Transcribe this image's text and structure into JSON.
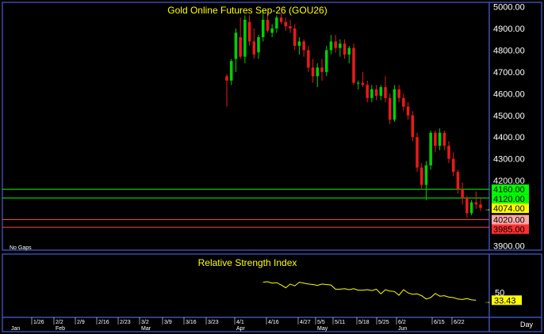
{
  "colors": {
    "background": "#000000",
    "border": "#3a4ba8",
    "title_text": "#ffff00",
    "axis_text": "#ffffff",
    "up_candle": "#00d000",
    "down_candle": "#e81a1a",
    "rsi_line": "#ffff00",
    "line_4160": "#00ff00",
    "line_4120": "#00ff00",
    "line_4020": "#ff4040",
    "line_3985": "#ff4040",
    "tag_4160": "#00ff00",
    "tag_4120": "#00ff00",
    "tag_4074": "#ffff00",
    "tag_4020": "#ffa8a8",
    "tag_3985": "#ff3030"
  },
  "main_title": "Gold Online Futures Sep-26 (GOU26)",
  "rsi_title": "Relative Strength Index",
  "no_gaps_label": "No Gaps",
  "period_label": "Day",
  "chart_data": [
    {
      "type": "candlestick",
      "title": "Gold Online Futures Sep-26 (GOU26)",
      "ylim": [
        3880,
        5020
      ],
      "y_ticks": [
        "5000.00",
        "4900.00",
        "4800.00",
        "4700.00",
        "4600.00",
        "4500.00",
        "4400.00",
        "4300.00",
        "4200.00",
        "4100.00",
        "4000.00",
        "3900.00"
      ],
      "y_tick_values": [
        5000,
        4900,
        4800,
        4700,
        4600,
        4500,
        4400,
        4300,
        4200,
        4100,
        4000,
        3900
      ],
      "price_lines": [
        {
          "value": 4160,
          "label": "4160.00",
          "key": "4160"
        },
        {
          "value": 4120,
          "label": "4120.00",
          "key": "4120"
        },
        {
          "value": 4020,
          "label": "4020.00",
          "key": "4020"
        },
        {
          "value": 3985,
          "label": "3985.00",
          "key": "3985"
        }
      ],
      "last_price": {
        "value": 4074,
        "label": "4074.00"
      },
      "candles": [
        {
          "open": 4680,
          "high": 4690,
          "low": 4540,
          "close": 4660
        },
        {
          "open": 4660,
          "high": 4760,
          "low": 4640,
          "close": 4750
        },
        {
          "open": 4760,
          "high": 4900,
          "low": 4700,
          "close": 4880
        },
        {
          "open": 4860,
          "high": 4950,
          "low": 4760,
          "close": 4770
        },
        {
          "open": 4770,
          "high": 4960,
          "low": 4740,
          "close": 4940
        },
        {
          "open": 4930,
          "high": 4960,
          "low": 4820,
          "close": 4840
        },
        {
          "open": 4840,
          "high": 4900,
          "low": 4760,
          "close": 4780
        },
        {
          "open": 4790,
          "high": 4870,
          "low": 4760,
          "close": 4860
        },
        {
          "open": 4860,
          "high": 4980,
          "low": 4840,
          "close": 4940
        },
        {
          "open": 4940,
          "high": 4970,
          "low": 4880,
          "close": 4890
        },
        {
          "open": 4880,
          "high": 4920,
          "low": 4860,
          "close": 4900
        },
        {
          "open": 4900,
          "high": 4960,
          "low": 4880,
          "close": 4950
        },
        {
          "open": 4950,
          "high": 4970,
          "low": 4920,
          "close": 4930
        },
        {
          "open": 4930,
          "high": 4950,
          "low": 4890,
          "close": 4910
        },
        {
          "open": 4910,
          "high": 4940,
          "low": 4880,
          "close": 4900
        },
        {
          "open": 4900,
          "high": 4920,
          "low": 4800,
          "close": 4820
        },
        {
          "open": 4820,
          "high": 4860,
          "low": 4780,
          "close": 4840
        },
        {
          "open": 4840,
          "high": 4850,
          "low": 4770,
          "close": 4800
        },
        {
          "open": 4800,
          "high": 4820,
          "low": 4700,
          "close": 4720
        },
        {
          "open": 4720,
          "high": 4760,
          "low": 4650,
          "close": 4680
        },
        {
          "open": 4680,
          "high": 4740,
          "low": 4630,
          "close": 4720
        },
        {
          "open": 4720,
          "high": 4760,
          "low": 4660,
          "close": 4700
        },
        {
          "open": 4700,
          "high": 4820,
          "low": 4680,
          "close": 4800
        },
        {
          "open": 4800,
          "high": 4870,
          "low": 4780,
          "close": 4840
        },
        {
          "open": 4840,
          "high": 4870,
          "low": 4790,
          "close": 4810
        },
        {
          "open": 4810,
          "high": 4850,
          "low": 4770,
          "close": 4830
        },
        {
          "open": 4830,
          "high": 4850,
          "low": 4760,
          "close": 4780
        },
        {
          "open": 4780,
          "high": 4820,
          "low": 4740,
          "close": 4810
        },
        {
          "open": 4810,
          "high": 4830,
          "low": 4640,
          "close": 4650
        },
        {
          "open": 4650,
          "high": 4660,
          "low": 4620,
          "close": 4650
        },
        {
          "open": 4650,
          "high": 4700,
          "low": 4630,
          "close": 4640
        },
        {
          "open": 4640,
          "high": 4660,
          "low": 4560,
          "close": 4580
        },
        {
          "open": 4580,
          "high": 4640,
          "low": 4560,
          "close": 4620
        },
        {
          "open": 4620,
          "high": 4640,
          "low": 4570,
          "close": 4590
        },
        {
          "open": 4590,
          "high": 4640,
          "low": 4570,
          "close": 4630
        },
        {
          "open": 4630,
          "high": 4680,
          "low": 4560,
          "close": 4580
        },
        {
          "open": 4580,
          "high": 4600,
          "low": 4460,
          "close": 4480
        },
        {
          "open": 4480,
          "high": 4640,
          "low": 4470,
          "close": 4620
        },
        {
          "open": 4620,
          "high": 4640,
          "low": 4560,
          "close": 4580
        },
        {
          "open": 4580,
          "high": 4600,
          "low": 4520,
          "close": 4540
        },
        {
          "open": 4540,
          "high": 4560,
          "low": 4480,
          "close": 4500
        },
        {
          "open": 4500,
          "high": 4520,
          "low": 4380,
          "close": 4400
        },
        {
          "open": 4400,
          "high": 4420,
          "low": 4240,
          "close": 4260
        },
        {
          "open": 4260,
          "high": 4280,
          "low": 4160,
          "close": 4180
        },
        {
          "open": 4180,
          "high": 4290,
          "low": 4110,
          "close": 4270
        },
        {
          "open": 4270,
          "high": 4430,
          "low": 4250,
          "close": 4420
        },
        {
          "open": 4420,
          "high": 4430,
          "low": 4330,
          "close": 4360
        },
        {
          "open": 4360,
          "high": 4440,
          "low": 4340,
          "close": 4420
        },
        {
          "open": 4420,
          "high": 4430,
          "low": 4340,
          "close": 4360
        },
        {
          "open": 4360,
          "high": 4380,
          "low": 4280,
          "close": 4300
        },
        {
          "open": 4300,
          "high": 4330,
          "low": 4220,
          "close": 4240
        },
        {
          "open": 4240,
          "high": 4250,
          "low": 4140,
          "close": 4160
        },
        {
          "open": 4160,
          "high": 4190,
          "low": 4090,
          "close": 4120
        },
        {
          "open": 4120,
          "high": 4130,
          "low": 4030,
          "close": 4050
        },
        {
          "open": 4050,
          "high": 4110,
          "low": 4040,
          "close": 4100
        },
        {
          "open": 4100,
          "high": 4150,
          "low": 4070,
          "close": 4090
        },
        {
          "open": 4090,
          "high": 4120,
          "low": 4060,
          "close": 4074
        }
      ]
    },
    {
      "type": "line",
      "title": "Relative Strength Index",
      "ylim": [
        0,
        100
      ],
      "y_ticks": [
        "50"
      ],
      "y_tick_values": [
        50
      ],
      "last_value": {
        "value": 33.43,
        "label": "33.43"
      },
      "start_index": 8,
      "values": [
        72,
        73,
        70,
        71,
        66,
        60,
        68,
        64,
        72,
        70,
        68,
        67,
        65,
        68,
        67,
        66,
        57,
        57,
        58,
        56,
        58,
        55,
        55,
        56,
        54,
        57,
        47,
        56,
        53,
        52,
        44,
        56,
        49,
        46,
        47,
        43,
        36,
        39,
        48,
        42,
        43,
        40,
        39,
        36,
        35,
        37,
        34,
        33.43
      ]
    }
  ],
  "x_axis": {
    "tick_labels": [
      "1/26",
      "2/2",
      "2/9",
      "2/16",
      "2/23",
      "3/2",
      "3/9",
      "3/16",
      "3/23",
      "4/1",
      "4/16",
      "4/27",
      "5/5",
      "5/11",
      "5/18",
      "5/25",
      "6/2",
      "6/15",
      "6/22"
    ],
    "month_labels": [
      "Jan",
      "Feb",
      "Mar",
      "Apr",
      "May",
      "Jun"
    ]
  }
}
